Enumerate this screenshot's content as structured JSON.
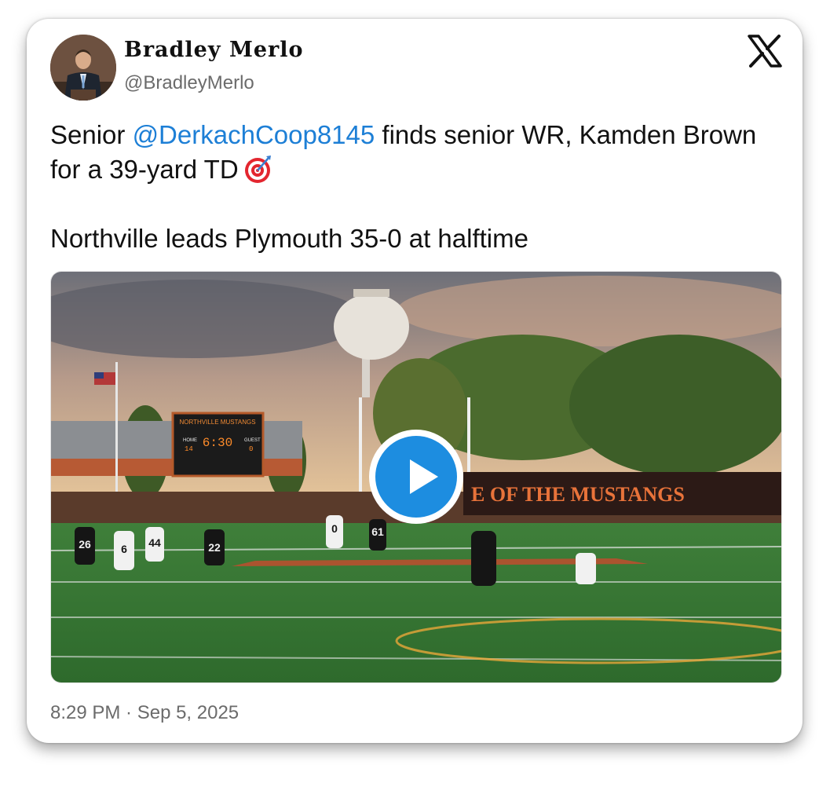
{
  "author": {
    "name": "Bradley Merlo",
    "handle": "@BradleyMerlo"
  },
  "tweet": {
    "line1_prefix": "Senior ",
    "mention": "@DerkachCoop8145",
    "line1_suffix": " finds senior WR, Kamden Brown for a 39-yard TD",
    "emoji": "target-emoji",
    "paragraph2": "Northville leads Plymouth 35-0 at halftime",
    "timestamp": "8:29 PM · Sep 5, 2025"
  },
  "media": {
    "type": "video",
    "play_icon": "play-icon",
    "scoreboard_title": "NORTHVILLE MUSTANGS",
    "scoreboard_clock": "6:30",
    "scoreboard_home_label": "HOME",
    "scoreboard_guest_label": "GUEST",
    "scoreboard_home": "14",
    "scoreboard_guest": "0",
    "banner_text": "E OF THE MUSTANGS",
    "jerseys": [
      "26",
      "6",
      "44",
      "22",
      "0",
      "61"
    ]
  },
  "colors": {
    "mention": "#1d7fd6",
    "play_button": "#1d8de0",
    "text": "#111111",
    "meta": "#6b6b6b"
  },
  "icons": {
    "brand": "x-logo-icon"
  }
}
